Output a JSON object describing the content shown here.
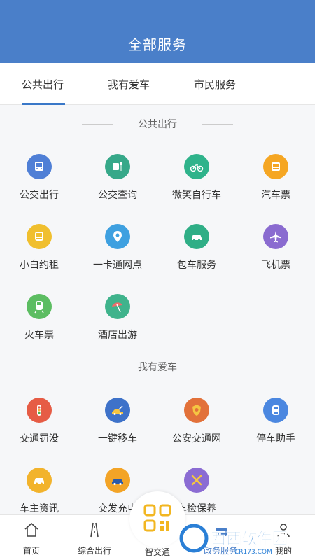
{
  "header": {
    "title": "全部服务"
  },
  "tabs": [
    {
      "label": "公共出行",
      "active": true
    },
    {
      "label": "我有爱车",
      "active": false
    },
    {
      "label": "市民服务",
      "active": false
    }
  ],
  "sections": [
    {
      "title": "公共出行",
      "items": [
        {
          "label": "公交出行",
          "icon": "bus-icon",
          "color": "#4f7fd6"
        },
        {
          "label": "公交查询",
          "icon": "bus-stop-icon",
          "color": "#36a889"
        },
        {
          "label": "微笑自行车",
          "icon": "bicycle-icon",
          "color": "#2fb38b"
        },
        {
          "label": "汽车票",
          "icon": "coach-ticket-icon",
          "color": "#f5a623"
        },
        {
          "label": "小白约租",
          "icon": "taxi-icon",
          "color": "#f0bf2e"
        },
        {
          "label": "一卡通网点",
          "icon": "location-pin-icon",
          "color": "#3ea0e0"
        },
        {
          "label": "包车服务",
          "icon": "car-icon",
          "color": "#2fae86"
        },
        {
          "label": "飞机票",
          "icon": "airplane-icon",
          "color": "#8a6bd0"
        },
        {
          "label": "火车票",
          "icon": "train-icon",
          "color": "#5cbd62"
        },
        {
          "label": "酒店出游",
          "icon": "beach-umbrella-icon",
          "color": "#3fb38c"
        }
      ]
    },
    {
      "title": "我有爱车",
      "items": [
        {
          "label": "交通罚没",
          "icon": "traffic-light-icon",
          "color": "#e65c45"
        },
        {
          "label": "一键移车",
          "icon": "tow-truck-icon",
          "color": "#3e72c9"
        },
        {
          "label": "公安交通网",
          "icon": "police-badge-icon",
          "color": "#e2713a"
        },
        {
          "label": "停车助手",
          "icon": "parking-car-icon",
          "color": "#4b87e0"
        },
        {
          "label": "车主资讯",
          "icon": "car-news-icon",
          "color": "#f2b32c"
        },
        {
          "label": "交发充电",
          "icon": "charging-car-icon",
          "color": "#f3a427"
        },
        {
          "label": "车检保养",
          "icon": "tools-icon",
          "color": "#8b6cd3"
        }
      ]
    }
  ],
  "bottom_nav": [
    {
      "label": "首页",
      "icon": "home-icon"
    },
    {
      "label": "综合出行",
      "icon": "road-icon"
    },
    {
      "label": "智交通",
      "icon": "qr-icon"
    },
    {
      "label": "政务服务",
      "icon": "government-icon"
    },
    {
      "label": "我的",
      "icon": "user-icon"
    }
  ],
  "watermark": {
    "text": "西西软件园",
    "sub": "CR173.COM"
  }
}
